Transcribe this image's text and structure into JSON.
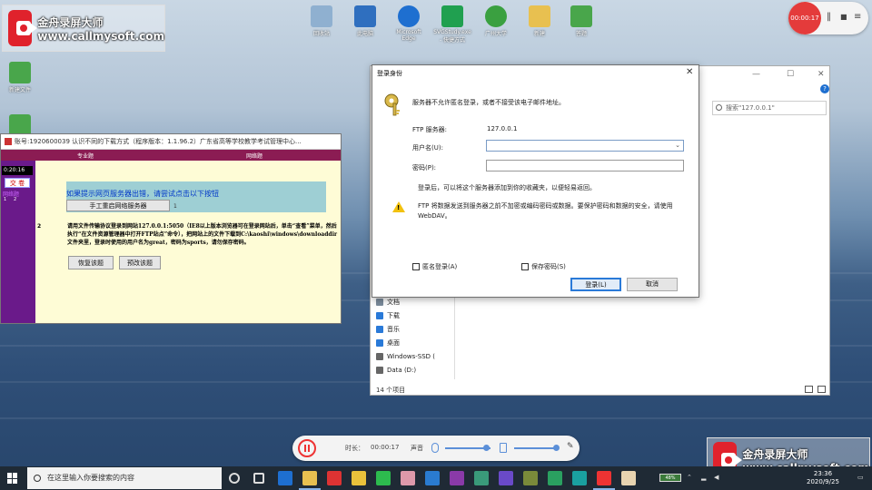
{
  "watermark": {
    "name": "金舟录屏大师",
    "url": "www.callmysoft.com"
  },
  "desktop_icons": [
    {
      "label": "回收站",
      "color": "#8fb0d0"
    },
    {
      "label": "此电脑",
      "color": "#2f6fbf"
    },
    {
      "label": "Microsoft Edge",
      "color": "#1e6fd0"
    },
    {
      "label": "SVGStudy.exe - 快捷方式",
      "color": "#20a050"
    },
    {
      "label": "广州大学",
      "color": "#3aa040"
    },
    {
      "label": "新建",
      "color": "#e8c050"
    },
    {
      "label": "答题",
      "color": "#49a64b"
    },
    {
      "label": "新建文件",
      "color": "#49a64b"
    },
    {
      "label": "新建",
      "color": "#49a64b"
    }
  ],
  "record_widget": {
    "time": "00:00:17",
    "pause": "‖",
    "stop": "■",
    "more": "≡"
  },
  "legacy": {
    "title": "账号:1920600039 认识不同的下载方式（程序版本：1.1.96.2）广东省高等学校教学考试管理中心...",
    "tab_left": "专业题",
    "tab_right": "网络题",
    "timer": "0:20:16",
    "side_button": "交 卷",
    "side_link": "网络题",
    "side_nums": [
      "1",
      "2"
    ],
    "notice_text": "如果提示网页服务器出错，请尝试点击以下按钮",
    "restart_btn": "手工重启网络服务器",
    "notice_mark": "1",
    "question_num": "2",
    "instruction": "请用文件传输协议登录到网站127.0.0.1:5050（IE8以上版本浏览器可在登录网站后，单击“查看”菜单，然后执行“在文件资源管理器中打开FTP站点”命令），把网站上的文件下载到C:\\kaoshi\\windows\\downloaddir文件夹里，登录时使用的用户名为great，密码为sports，请勿保存密码。",
    "btn_restore": "恢复该题",
    "btn_redo": "预改该题"
  },
  "explorer": {
    "min": "—",
    "max": "☐",
    "close": "✕",
    "refresh": "↻",
    "search_placeholder": "搜索\"127.0.0.1\"",
    "nav": [
      {
        "label": "文档",
        "color": "#7b8b9b"
      },
      {
        "label": "下载",
        "color": "#2a7ad8"
      },
      {
        "label": "音乐",
        "color": "#2a7ad8"
      },
      {
        "label": "桌面",
        "color": "#2a7ad8"
      },
      {
        "label": "Windows-SSD (",
        "color": "#666"
      },
      {
        "label": "Data (D:)",
        "color": "#666"
      }
    ],
    "status": "14 个项目",
    "help": "?"
  },
  "dialog": {
    "title": "登录身份",
    "close": "✕",
    "message": "服务器不允许匿名登录，或者不接受该电子邮件地址。",
    "ftp_label": "FTP 服务器:",
    "ftp_value": "127.0.0.1",
    "user_label": "用户名(U):",
    "user_value": "",
    "password_label": "密码(P):",
    "password_value": "",
    "note": "登录后，可以将这个服务器添加到你的收藏夹，以便轻易返回。",
    "warning": "FTP 将数据发送到服务器之前不加密或编码密码或数据。要保护密码和数据的安全，请使用 WebDAV。",
    "anon_label": "匿名登录(A)",
    "save_label": "保存密码(S)",
    "login_btn": "登录(L)",
    "cancel_btn": "取消"
  },
  "recorder_bar": {
    "duration_label": "时长：",
    "duration": "00:00:17",
    "sound_label": "声音",
    "mic_level": 0.7,
    "speaker_level": 0.95
  },
  "taskbar": {
    "search_placeholder": "在这里输入你要搜索的内容",
    "time": "23:36",
    "date": "2020/9/25",
    "battery": "48%",
    "apps": [
      {
        "name": "task-view",
        "color": "#ddd"
      },
      {
        "name": "cortana",
        "color": "#ddd"
      },
      {
        "name": "edge",
        "color": "#1e6fd0"
      },
      {
        "name": "file-explorer",
        "color": "#e8c050"
      },
      {
        "name": "netease-music",
        "color": "#d33"
      },
      {
        "name": "app-yellow",
        "color": "#e9c23b"
      },
      {
        "name": "wechat",
        "color": "#2dbb4e"
      },
      {
        "name": "app-figure",
        "color": "#d9a"
      },
      {
        "name": "photoshop",
        "color": "#2a7bd0"
      },
      {
        "name": "premiere",
        "color": "#8a3aa8"
      },
      {
        "name": "audition",
        "color": "#3a9a7a"
      },
      {
        "name": "after-effects",
        "color": "#6a4ac8"
      },
      {
        "name": "app-box",
        "color": "#7a8a3a"
      },
      {
        "name": "app-green",
        "color": "#2aa060"
      },
      {
        "name": "app-teal",
        "color": "#1aa0a0"
      },
      {
        "name": "recorder",
        "color": "#e33"
      },
      {
        "name": "app-face",
        "color": "#e8d4b0"
      }
    ]
  }
}
